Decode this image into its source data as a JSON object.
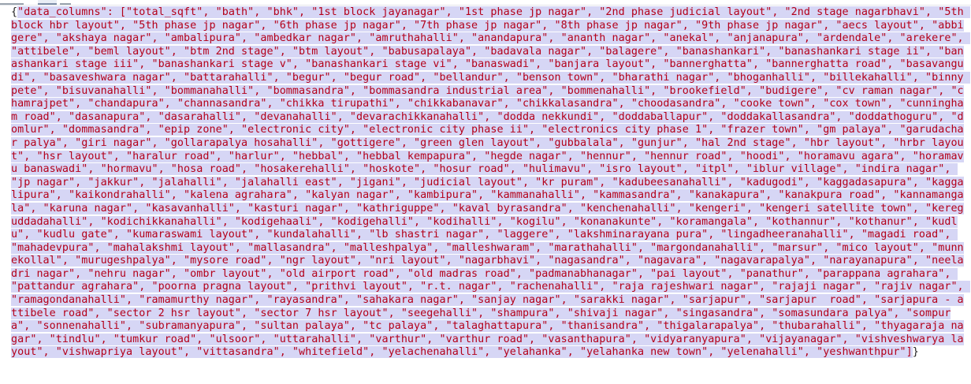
{
  "editor": {
    "content_prefix": "{",
    "content": "\"data_columns\": [\"total_sqft\", \"bath\", \"bhk\", \"1st block jayanagar\", \"1st phase jp nagar\", \"2nd phase judicial layout\", \"2nd stage nagarbhavi\", \"5th block hbr layout\", \"5th phase jp nagar\", \"6th phase jp nagar\", \"7th phase jp nagar\", \"8th phase jp nagar\", \"9th phase jp nagar\", \"aecs layout\", \"abbigere\", \"akshaya nagar\", \"ambalipura\", \"ambedkar nagar\", \"amruthahalli\", \"anandapura\", \"ananth nagar\", \"anekal\", \"anjanapura\", \"ardendale\", \"arekere\", \"attibele\", \"beml layout\", \"btm 2nd stage\", \"btm layout\", \"babusapalaya\", \"badavala nagar\", \"balagere\", \"banashankari\", \"banashankari stage ii\", \"banashankari stage iii\", \"banashankari stage v\", \"banashankari stage vi\", \"banaswadi\", \"banjara layout\", \"bannerghatta\", \"bannerghatta road\", \"basavangudi\", \"basaveshwara nagar\", \"battarahalli\", \"begur\", \"begur road\", \"bellandur\", \"benson town\", \"bharathi nagar\", \"bhoganhalli\", \"billekahalli\", \"binny pete\", \"bisuvanahalli\", \"bommanahalli\", \"bommasandra\", \"bommasandra industrial area\", \"bommenahalli\", \"brookefield\", \"budigere\", \"cv raman nagar\", \"chamrajpet\", \"chandapura\", \"channasandra\", \"chikka tirupathi\", \"chikkabanavar\", \"chikkalasandra\", \"choodasandra\", \"cooke town\", \"cox town\", \"cunningham road\", \"dasanapura\", \"dasarahalli\", \"devanahalli\", \"devarachikkanahalli\", \"dodda nekkundi\", \"doddaballapur\", \"doddakallasandra\", \"doddathoguru\", \"domlur\", \"dommasandra\", \"epip zone\", \"electronic city\", \"electronic city phase ii\", \"electronics city phase 1\", \"frazer town\", \"gm palaya\", \"garudachar palya\", \"giri nagar\", \"gollarapalya hosahalli\", \"gottigere\", \"green glen layout\", \"gubbalala\", \"gunjur\", \"hal 2nd stage\", \"hbr layout\", \"hrbr layout\", \"hsr layout\", \"haralur road\", \"harlur\", \"hebbal\", \"hebbal kempapura\", \"hegde nagar\", \"hennur\", \"hennur road\", \"hoodi\", \"horamavu agara\", \"horamavu banaswadi\", \"hormavu\", \"hosa road\", \"hosakerehalli\", \"hoskote\", \"hosur road\", \"hulimavu\", \"isro layout\", \"itpl\", \"iblur village\", \"indira nagar\", \"jp nagar\", \"jakkur\", \"jalahalli\", \"jalahalli east\", \"jigani\", \"judicial layout\", \"kr puram\", \"kadubeesanahalli\", \"kadugodi\", \"kaggadasapura\", \"kaggalipura\", \"kaikondrahalli\", \"kalena agrahara\", \"kalyan nagar\", \"kambipura\", \"kammanahalli\", \"kammasandra\", \"kanakapura\", \"kanakpura road\", \"kannamangala\", \"karuna nagar\", \"kasavanhalli\", \"kasturi nagar\", \"kathriguppe\", \"kaval byrasandra\", \"kenchenahalli\", \"kengeri\", \"kengeri satellite town\", \"kereguddadahalli\", \"kodichikkanahalli\", \"kodigehaali\", \"kodigehalli\", \"kodihalli\", \"kogilu\", \"konanakunte\", \"koramangala\", \"kothannur\", \"kothanur\", \"kudlu\", \"kudlu gate\", \"kumaraswami layout\", \"kundalahalli\", \"lb shastri nagar\", \"laggere\", \"lakshminarayana pura\", \"lingadheeranahalli\", \"magadi road\", \"mahadevpura\", \"mahalakshmi layout\", \"mallasandra\", \"malleshpalya\", \"malleshwaram\", \"marathahalli\", \"margondanahalli\", \"marsur\", \"mico layout\", \"munnekollal\", \"murugeshpalya\", \"mysore road\", \"ngr layout\", \"nri layout\", \"nagarbhavi\", \"nagasandra\", \"nagavara\", \"nagavarapalya\", \"narayanapura\", \"neeladri nagar\", \"nehru nagar\", \"ombr layout\", \"old airport road\", \"old madras road\", \"padmanabhanagar\", \"pai layout\", \"panathur\", \"parappana agrahara\", \"pattandur agrahara\", \"poorna pragna layout\", \"prithvi layout\", \"r.t. nagar\", \"rachenahalli\", \"raja rajeshwari nagar\", \"rajaji nagar\", \"rajiv nagar\", \"ramagondanahalli\", \"ramamurthy nagar\", \"rayasandra\", \"sahakara nagar\", \"sanjay nagar\", \"sarakki nagar\", \"sarjapur\", \"sarjapur  road\", \"sarjapura - attibele road\", \"sector 2 hsr layout\", \"sector 7 hsr layout\", \"seegehalli\", \"shampura\", \"shivaji nagar\", \"singasandra\", \"somasundara palya\", \"sompura\", \"sonnenahalli\", \"subramanyapura\", \"sultan palaya\", \"tc palaya\", \"talaghattapura\", \"thanisandra\", \"thigalarapalya\", \"thubarahalli\", \"thyagaraja nagar\", \"tindlu\", \"tumkur road\", \"ulsoor\", \"uttarahalli\", \"varthur\", \"varthur road\", \"vasanthapura\", \"vidyaranyapura\", \"vijayanagar\", \"vishveshwarya layout\", \"vishwapriya layout\", \"vittasandra\", \"whitefield\", \"yelachenahalli\", \"yelahanka\", \"yelahanka new town\", \"yelenahalli\", \"yeshwanthpur\"]",
    "content_suffix": "}"
  }
}
